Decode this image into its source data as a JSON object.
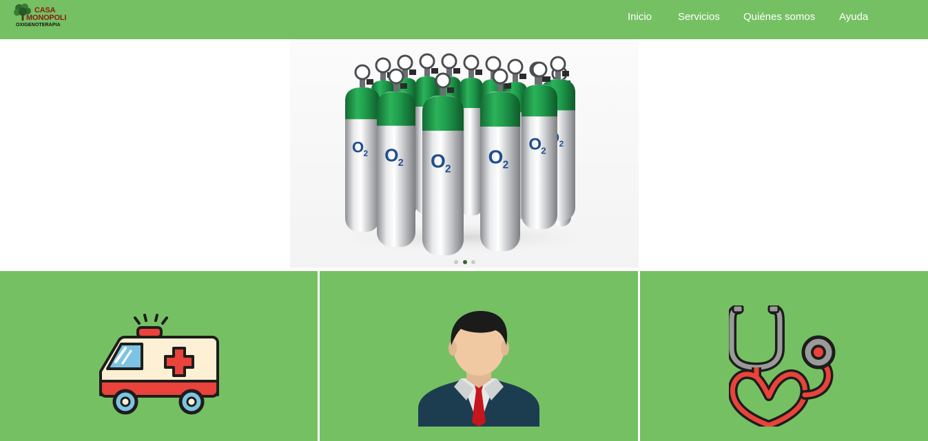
{
  "brand": {
    "line1": "CASA",
    "line2": "MONOPOLI",
    "line3": "OXIGENOTERAPIA",
    "icon": "tree-icon"
  },
  "nav": {
    "items": [
      {
        "label": "Inicio"
      },
      {
        "label": "Servicios"
      },
      {
        "label": "Quiénes somos"
      },
      {
        "label": "Ayuda"
      }
    ]
  },
  "hero": {
    "image": "oxygen-cylinders-image",
    "cylinder_label": "O2",
    "carousel": {
      "count": 3,
      "active_index": 1
    }
  },
  "panels": [
    {
      "icon": "ambulance-icon"
    },
    {
      "icon": "businessman-icon"
    },
    {
      "icon": "stethoscope-heart-icon"
    }
  ],
  "colors": {
    "header_bg": "#75c063",
    "panel_bg": "#75c063",
    "brand_text": "#8b1a14",
    "nav_text": "#ffffff",
    "cylinder_green": "#1e9a4b",
    "o2_label": "#1f4e8c",
    "dot_active": "#2e6b25",
    "dot_inactive": "#c9c9c9"
  }
}
